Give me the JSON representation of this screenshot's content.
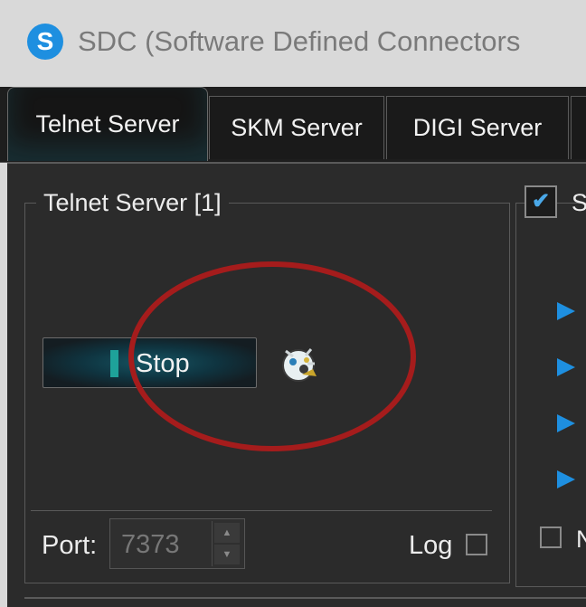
{
  "window": {
    "title": "SDC (Software Defined Connectors",
    "logo_letter": "S"
  },
  "tabs": [
    {
      "label": "Telnet Server",
      "active": true
    },
    {
      "label": "SKM Server",
      "active": false
    },
    {
      "label": "DIGI Server",
      "active": false
    }
  ],
  "telnet_group": {
    "title": "Telnet Server [1]",
    "stop_label": "Stop",
    "port_label": "Port:",
    "port_value": "7373",
    "log_label": "Log",
    "log_checked": false
  },
  "right_panel": {
    "header_checked": true,
    "header_cut_text": "S",
    "checkbox_cut_text": "N"
  },
  "colors": {
    "accent": "#1e8fe0",
    "indicator": "#1ea29a",
    "annotation": "#a51c1c"
  },
  "icons": {
    "app": "sdc-logo-icon",
    "status": "running-status-icon",
    "arrow": "play-arrow-icon"
  }
}
